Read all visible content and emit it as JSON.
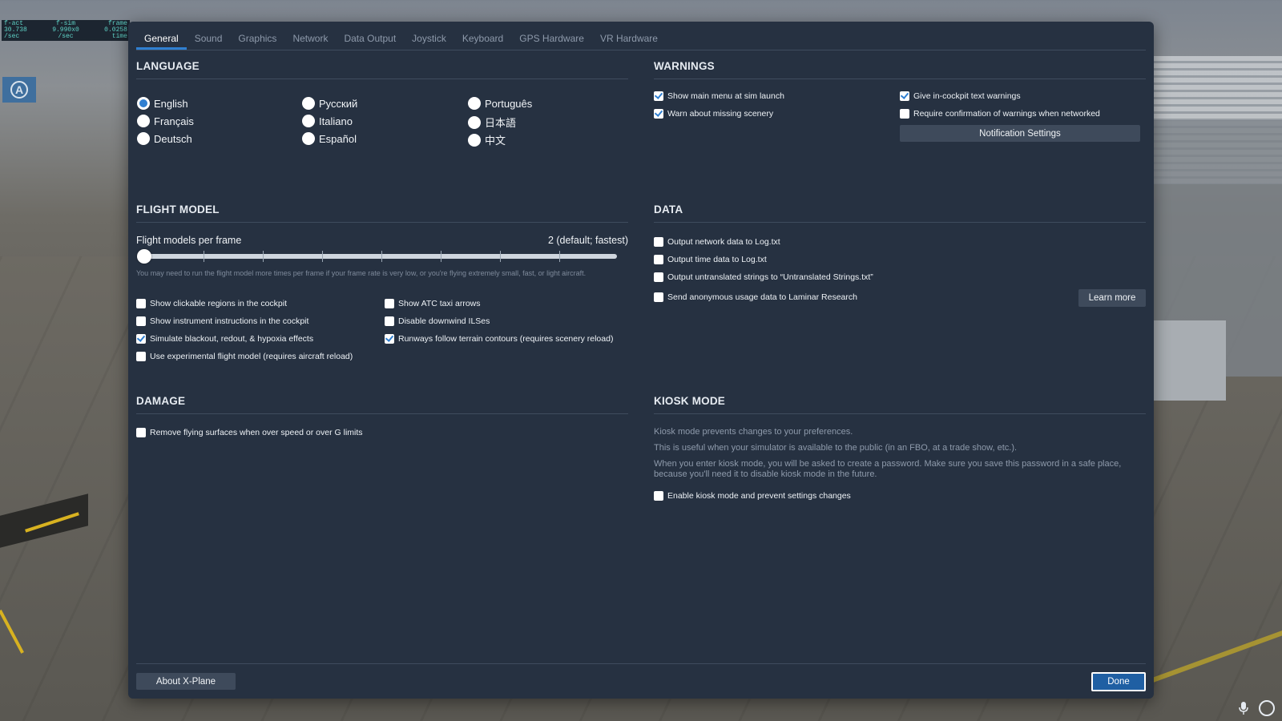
{
  "overlay": {
    "fps_labels": [
      "f-act",
      "f-sim",
      "frame"
    ],
    "fps_values": [
      "30.738",
      "9.990x0",
      "0.0258"
    ],
    "fps_units": [
      "/sec",
      "/sec",
      "time"
    ],
    "corner_letter": "A"
  },
  "tabs": [
    {
      "label": "General",
      "active": true
    },
    {
      "label": "Sound"
    },
    {
      "label": "Graphics"
    },
    {
      "label": "Network"
    },
    {
      "label": "Data Output"
    },
    {
      "label": "Joystick"
    },
    {
      "label": "Keyboard"
    },
    {
      "label": "GPS Hardware"
    },
    {
      "label": "VR Hardware"
    }
  ],
  "language": {
    "title": "LANGUAGE",
    "options": [
      "English",
      "Français",
      "Deutsch",
      "Русский",
      "Italiano",
      "Español",
      "Português",
      "日本語",
      "中文"
    ],
    "selected": "English"
  },
  "warnings": {
    "title": "WARNINGS",
    "items": [
      {
        "label": "Show main menu at sim launch",
        "checked": true
      },
      {
        "label": "Warn about missing scenery",
        "checked": true
      },
      {
        "label": "Give in-cockpit text warnings",
        "checked": true
      },
      {
        "label": "Require confirmation of warnings when networked",
        "checked": false
      }
    ],
    "notification_button": "Notification Settings"
  },
  "flight_model": {
    "title": "FLIGHT MODEL",
    "slider_label": "Flight models per frame",
    "slider_value": "2 (default; fastest)",
    "slider_fraction": 0.0,
    "note": "You may need to run the flight model more times per frame if your frame rate is very low, or you're flying extremely small, fast, or light aircraft.",
    "items": [
      {
        "label": "Show clickable regions in the cockpit",
        "checked": false
      },
      {
        "label": "Show instrument instructions in the cockpit",
        "checked": false
      },
      {
        "label": "Simulate blackout, redout, & hypoxia effects",
        "checked": true
      },
      {
        "label": "Use experimental flight model (requires aircraft reload)",
        "checked": false
      },
      {
        "label": "Show ATC taxi arrows",
        "checked": false
      },
      {
        "label": "Disable downwind ILSes",
        "checked": false
      },
      {
        "label": "Runways follow terrain contours (requires scenery reload)",
        "checked": true
      }
    ]
  },
  "data": {
    "title": "DATA",
    "items": [
      {
        "label": "Output network data to Log.txt",
        "checked": false
      },
      {
        "label": "Output time data to Log.txt",
        "checked": false
      },
      {
        "label": "Output untranslated strings to “Untranslated Strings.txt”",
        "checked": false
      },
      {
        "label": "Send anonymous usage data to Laminar Research",
        "checked": false
      }
    ],
    "learn_more": "Learn more"
  },
  "damage": {
    "title": "DAMAGE",
    "items": [
      {
        "label": "Remove flying surfaces when over speed or over G limits",
        "checked": false
      }
    ]
  },
  "kiosk": {
    "title": "KIOSK MODE",
    "line1": "Kiosk mode prevents changes to your preferences.",
    "line2": "This is useful when your simulator is available to the public (in an FBO, at a trade show, etc.).",
    "line3": "When you enter kiosk mode, you will be asked to create a password. Make sure you save this password in a safe place, because you'll need it to disable kiosk mode in the future.",
    "enable": {
      "label": "Enable kiosk mode and prevent settings changes",
      "checked": false
    }
  },
  "footer": {
    "about": "About X-Plane",
    "done": "Done"
  },
  "colors": {
    "accent": "#2f7fd1",
    "dialog_bg": "#263141",
    "button_bg": "#3e4a5b"
  }
}
